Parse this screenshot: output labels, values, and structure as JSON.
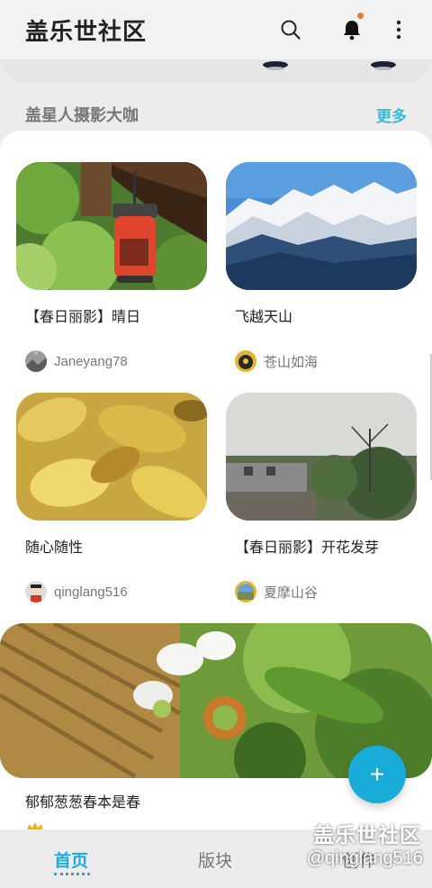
{
  "header": {
    "title": "盖乐世社区",
    "icons": [
      "search-icon",
      "bell-icon",
      "more-vertical-icon"
    ],
    "notification_dot_color": "#f07a2a"
  },
  "section": {
    "title": "盖星人摄影大咖",
    "more_label": "更多",
    "accent_color": "#3ab8d8"
  },
  "posts": [
    {
      "title": "【春日丽影】晴日",
      "author": "Janeyang78",
      "image": "red lantern under wooden eaves"
    },
    {
      "title": "飞越天山",
      "author": "苍山如海",
      "image": "snowy mountains under blue sky"
    },
    {
      "title": "随心随性",
      "author": "qinglang516",
      "image": "yellow leaves"
    },
    {
      "title": "【春日丽影】开花发芽",
      "author": "夏摩山谷",
      "image": "rooftops and bare trees"
    }
  ],
  "featured": {
    "title": "郁郁葱葱春本是春",
    "image": "white blossom with green leaves"
  },
  "fab": {
    "label": "+",
    "color": "#1aacd8"
  },
  "nav": {
    "tabs": [
      "首页",
      "版块",
      "创作"
    ],
    "active_index": 0
  },
  "watermark": {
    "title": "盖乐世社区",
    "user": "@qinglang516"
  }
}
